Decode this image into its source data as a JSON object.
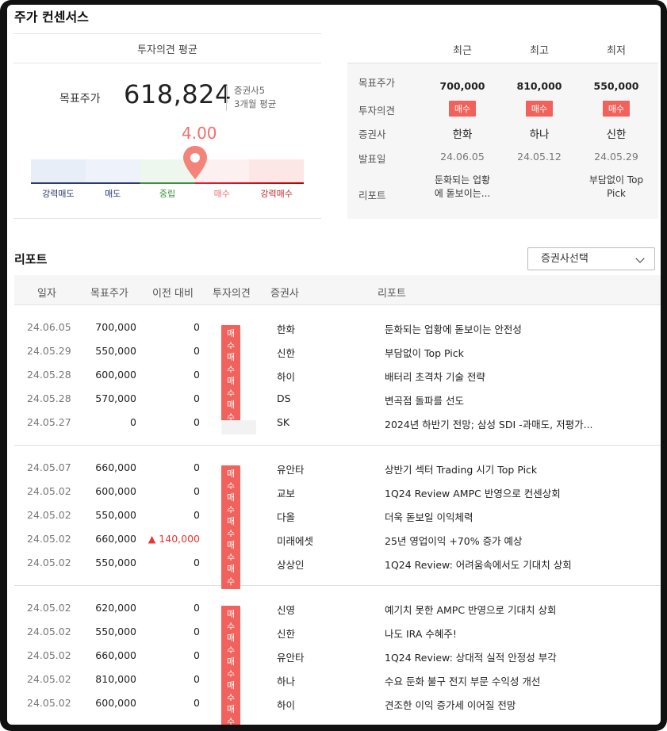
{
  "title": "주가 컨센서스",
  "summary": {
    "heading": "투자의견 평균",
    "target_label": "목표주가",
    "target_value": "618,824",
    "brokers_count": "증권사5",
    "period": "3개월 평균",
    "score": "4.00",
    "score_value": 4.0,
    "scale_labels": [
      "강력매도",
      "매도",
      "중립",
      "매수",
      "강력매수"
    ],
    "scale_colors": [
      "#2a3b70",
      "#2a3b70",
      "#3e8e3e",
      "#f06f6f",
      "#c62828"
    ]
  },
  "recent": {
    "columns": [
      "최근",
      "최고",
      "최저"
    ],
    "row_labels": {
      "target": "목표주가",
      "opinion": "투자의견",
      "broker": "증권사",
      "date": "발표일",
      "report": "리포트"
    },
    "cols": [
      {
        "target": "700,000",
        "opinion": "매수",
        "broker": "한화",
        "date": "24.06.05",
        "report_l1": "둔화되는 업황",
        "report_l2": "에 돋보이는..."
      },
      {
        "target": "810,000",
        "opinion": "매수",
        "broker": "하나",
        "date": "24.05.12",
        "report_l1": "",
        "report_l2": ""
      },
      {
        "target": "550,000",
        "opinion": "매수",
        "broker": "신한",
        "date": "24.05.29",
        "report_l1": "부담없이 Top",
        "report_l2": "Pick"
      }
    ]
  },
  "reports": {
    "title": "리포트",
    "select_label": "증권사선택",
    "headers": [
      "일자",
      "목표주가",
      "이전 대비",
      "투자의견",
      "증권사",
      "리포트"
    ],
    "rows": [
      {
        "date": "24.06.05",
        "target": "700,000",
        "diff": "0",
        "opinion": "매수",
        "broker": "한화",
        "report": "둔화되는 업황에 돋보이는 안전성"
      },
      {
        "date": "24.05.29",
        "target": "550,000",
        "diff": "0",
        "opinion": "매수",
        "broker": "신한",
        "report": "부담없이 Top Pick"
      },
      {
        "date": "24.05.28",
        "target": "600,000",
        "diff": "0",
        "opinion": "매수",
        "broker": "하이",
        "report": "배터리 초격차 기술 전략"
      },
      {
        "date": "24.05.28",
        "target": "570,000",
        "diff": "0",
        "opinion": "매수",
        "broker": "DS",
        "report": "변곡점 돌파를 선도"
      },
      {
        "date": "24.05.27",
        "target": "0",
        "diff": "0",
        "opinion": "",
        "broker": "SK",
        "report": "2024년 하반기 전망; 삼성 SDI -과매도, 저평가..."
      },
      {
        "date": "24.05.07",
        "target": "660,000",
        "diff": "0",
        "opinion": "매수",
        "broker": "유안타",
        "report": "상반기 섹터 Trading 시기 Top Pick"
      },
      {
        "date": "24.05.02",
        "target": "600,000",
        "diff": "0",
        "opinion": "매수",
        "broker": "교보",
        "report": "1Q24 Review AMPC 반영으로 컨센상회"
      },
      {
        "date": "24.05.02",
        "target": "550,000",
        "diff": "0",
        "opinion": "매수",
        "broker": "다올",
        "report": "더욱 돋보일 이익체력"
      },
      {
        "date": "24.05.02",
        "target": "660,000",
        "diff": "▲ 140,000",
        "opinion": "매수",
        "broker": "미래에셋",
        "report": "25년 영업이익 +70% 증가 예상"
      },
      {
        "date": "24.05.02",
        "target": "550,000",
        "diff": "0",
        "opinion": "매수",
        "broker": "상상인",
        "report": "1Q24 Review: 어려움속에서도 기대치 상회"
      },
      {
        "date": "24.05.02",
        "target": "620,000",
        "diff": "0",
        "opinion": "매수",
        "broker": "신영",
        "report": "예기치 못한 AMPC 반영으로 기대치 상회"
      },
      {
        "date": "24.05.02",
        "target": "550,000",
        "diff": "0",
        "opinion": "매수",
        "broker": "신한",
        "report": "나도 IRA 수혜주!"
      },
      {
        "date": "24.05.02",
        "target": "660,000",
        "diff": "0",
        "opinion": "매수",
        "broker": "유안타",
        "report": "1Q24 Review: 상대적 실적 안정성 부각"
      },
      {
        "date": "24.05.02",
        "target": "810,000",
        "diff": "0",
        "opinion": "매수",
        "broker": "하나",
        "report": "수요 둔화 불구 전지 부문 수익성 개선"
      },
      {
        "date": "24.05.02",
        "target": "600,000",
        "diff": "0",
        "opinion": "매수",
        "broker": "하이",
        "report": "견조한 이익 증가세 이어질 전망"
      }
    ]
  },
  "colors": {
    "accent": "#f06f6f",
    "badge": "#f0625b",
    "up": "#e33333"
  }
}
